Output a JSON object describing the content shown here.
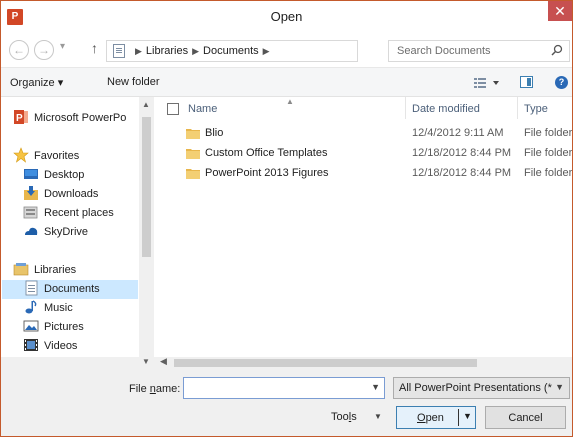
{
  "window": {
    "title": "Open",
    "app_icon_letter": "P",
    "close_glyph": "✕"
  },
  "nav": {
    "back_glyph": "←",
    "forward_glyph": "→",
    "recent_glyph": "▾",
    "up_glyph": "↑",
    "breadcrumb": [
      "Libraries",
      "Documents"
    ],
    "refresh_glyph": "↻",
    "search_placeholder": "Search Documents"
  },
  "toolbar": {
    "organize_label": "Organize ▾",
    "new_folder_label": "New folder",
    "help_glyph": "?"
  },
  "sidebar": {
    "items": [
      {
        "label": "Microsoft PowerPo",
        "icon": "powerpoint-icon"
      },
      {
        "label": "Favorites",
        "icon": "star-icon"
      },
      {
        "label": "Desktop",
        "icon": "desktop-icon"
      },
      {
        "label": "Downloads",
        "icon": "downloads-icon"
      },
      {
        "label": "Recent places",
        "icon": "recent-places-icon"
      },
      {
        "label": "SkyDrive",
        "icon": "skydrive-icon"
      },
      {
        "label": "Libraries",
        "icon": "libraries-icon"
      },
      {
        "label": "Documents",
        "icon": "documents-icon"
      },
      {
        "label": "Music",
        "icon": "music-icon"
      },
      {
        "label": "Pictures",
        "icon": "pictures-icon"
      },
      {
        "label": "Videos",
        "icon": "videos-icon"
      }
    ],
    "selected": "Documents"
  },
  "filelist": {
    "columns": {
      "name": "Name",
      "date": "Date modified",
      "type": "Type"
    },
    "rows": [
      {
        "name": "Blio",
        "date": "12/4/2012 9:11 AM",
        "type": "File folder"
      },
      {
        "name": "Custom Office Templates",
        "date": "12/18/2012 8:44 PM",
        "type": "File folder"
      },
      {
        "name": "PowerPoint 2013 Figures",
        "date": "12/18/2012 8:44 PM",
        "type": "File folder"
      }
    ]
  },
  "bottom": {
    "file_name_label_pre": "File ",
    "file_name_label_ul": "n",
    "file_name_label_post": "ame:",
    "file_name_value": "",
    "file_type_value": "All PowerPoint Presentations (*",
    "tools_pre": "Too",
    "tools_ul": "l",
    "tools_post": "s",
    "open_ul": "O",
    "open_post": "pen",
    "cancel_label": "Cancel"
  },
  "colors": {
    "accent_blue": "#3c7fb1",
    "selection": "#cce8ff",
    "close_red": "#c75050",
    "ppt_orange": "#d24726",
    "folder_yellow": "#e8b64c"
  }
}
